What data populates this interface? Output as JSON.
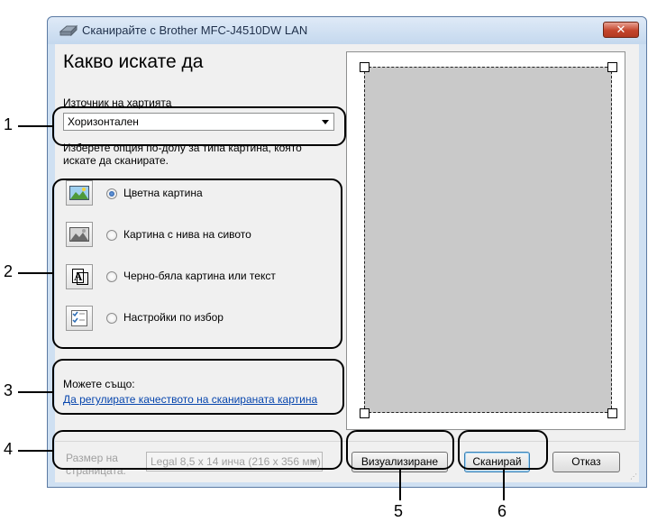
{
  "window": {
    "title": "Сканирайте с Brother MFC-J4510DW LAN",
    "close_symbol": "✕"
  },
  "main": {
    "heading": "Какво искате да",
    "paper_source_label": "Източник на хартията",
    "paper_source_underlined": "х",
    "paper_source_value": "Хоризонтален",
    "instructions": "Изберете опция по-долу за типа картина, която искате да сканирате.",
    "options": [
      {
        "label": "Цветна картина",
        "selected": true,
        "icon": "color-picture-icon"
      },
      {
        "label": "Картина с нива на сивото",
        "selected": false,
        "icon": "grayscale-picture-icon"
      },
      {
        "label": "Черно-бяла картина или текст",
        "selected": false,
        "icon": "bw-text-icon"
      },
      {
        "label": "Настройки по избор",
        "selected": false,
        "icon": "custom-settings-icon"
      }
    ],
    "also_label": "Можете също:",
    "quality_link": "Да регулирате качеството на сканираната картина",
    "page_size_label": "Размер на страницата:",
    "page_size_value": "Legal 8,5 x 14 инча (216 x 356 мм)"
  },
  "buttons": {
    "preview": "Визуализиране",
    "scan": "Сканирай",
    "cancel": "Отказ"
  },
  "callouts": [
    "1",
    "2",
    "3",
    "4",
    "5",
    "6"
  ],
  "colors": {
    "window_frame": "#cfe0f2",
    "client_bg": "#f0f0f0",
    "link": "#0645ad",
    "preview_area": "#c9c9c9",
    "close_button": "#c4452c"
  }
}
